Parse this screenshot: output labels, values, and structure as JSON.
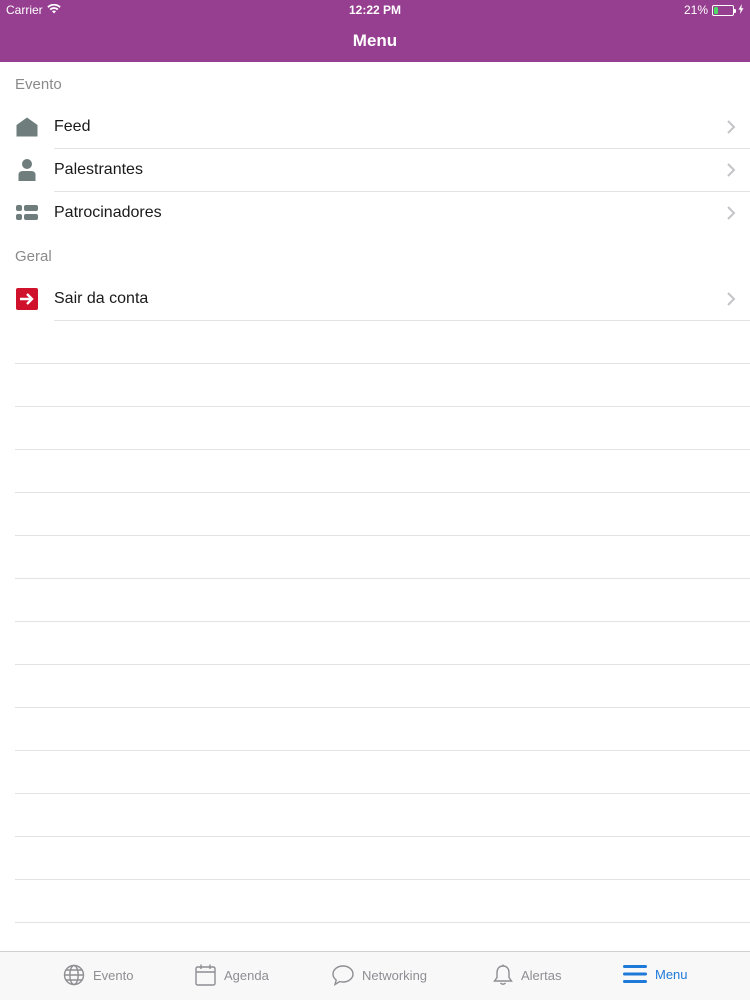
{
  "status": {
    "carrier": "Carrier",
    "time": "12:22 PM",
    "battery": "21%",
    "battery_level": 0.21
  },
  "nav": {
    "title": "Menu"
  },
  "sections": [
    {
      "header": "Evento",
      "items": [
        {
          "label": "Feed",
          "icon": "home-icon"
        },
        {
          "label": "Palestrantes",
          "icon": "person-icon"
        },
        {
          "label": "Patrocinadores",
          "icon": "list-icon"
        }
      ]
    },
    {
      "header": "Geral",
      "items": [
        {
          "label": "Sair da conta",
          "icon": "logout-icon"
        }
      ]
    }
  ],
  "tabs": [
    {
      "label": "Evento",
      "icon": "globe-icon",
      "active": false
    },
    {
      "label": "Agenda",
      "icon": "calendar-icon",
      "active": false
    },
    {
      "label": "Networking",
      "icon": "chat-bubble-icon",
      "active": false
    },
    {
      "label": "Alertas",
      "icon": "bell-icon",
      "active": false
    },
    {
      "label": "Menu",
      "icon": "hamburger-icon",
      "active": true
    }
  ],
  "colors": {
    "brand": "#963e8f",
    "active_tab": "#1e7ad8",
    "logout_accent": "#d0112b",
    "icon_gray": "#6f7d7d"
  }
}
